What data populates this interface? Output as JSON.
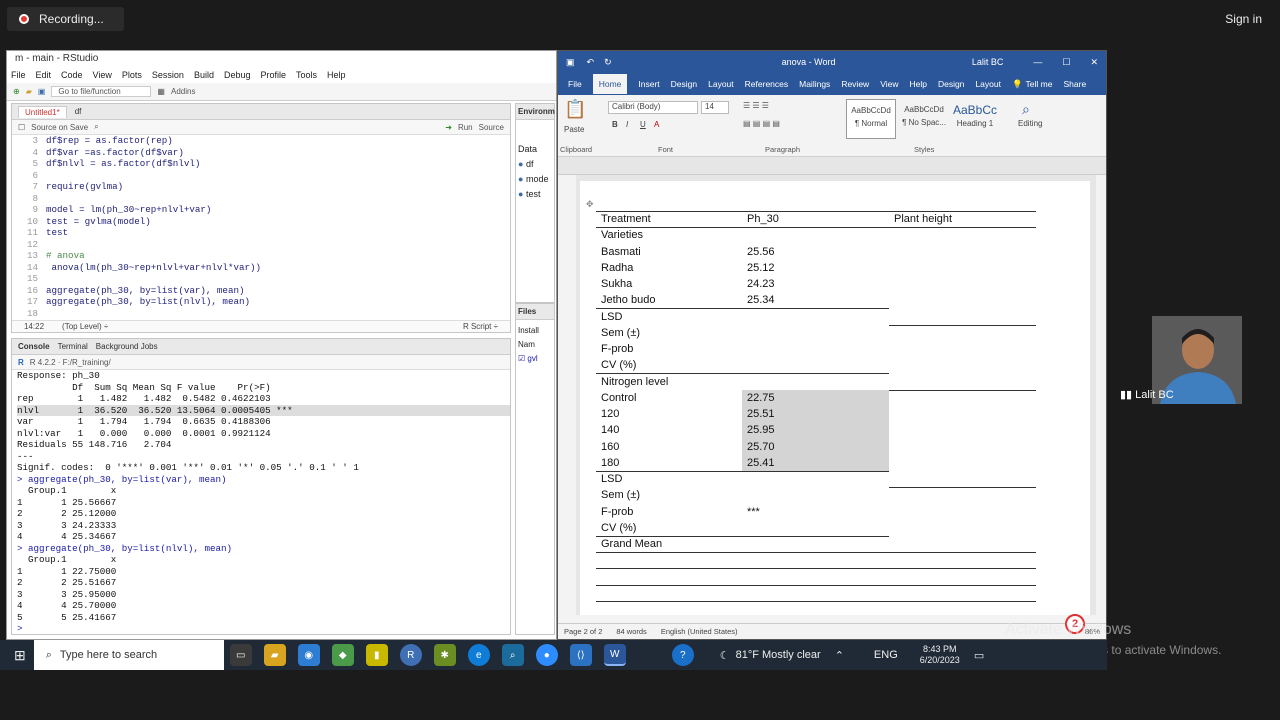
{
  "recording": {
    "label": "Recording..."
  },
  "signin": "Sign in",
  "rstudio": {
    "title": "m - main - RStudio",
    "menu": [
      "File",
      "Edit",
      "Code",
      "View",
      "Plots",
      "Session",
      "Build",
      "Debug",
      "Profile",
      "Tools",
      "Help"
    ],
    "goto_placeholder": "Go to file/function",
    "addins": "Addins",
    "editor_tabs": [
      "Untitled1*",
      "df"
    ],
    "source_on_save": "Source on Save",
    "run": "Run",
    "source": "Source",
    "code_lines": [
      {
        "n": "3",
        "t": "df$rep = as.factor(rep)"
      },
      {
        "n": "4",
        "t": "df$var  =as.factor(df$var)"
      },
      {
        "n": "5",
        "t": "df$nlvl = as.factor(df$nlvl)"
      },
      {
        "n": "6",
        "t": ""
      },
      {
        "n": "7",
        "t": "require(gvlma)"
      },
      {
        "n": "8",
        "t": ""
      },
      {
        "n": "9",
        "t": "model = lm(ph_30~rep+nlvl+var)"
      },
      {
        "n": "10",
        "t": "test = gvlma(model)"
      },
      {
        "n": "11",
        "t": "test"
      },
      {
        "n": "12",
        "t": ""
      },
      {
        "n": "13",
        "t": "# anova"
      },
      {
        "n": "14",
        "t": " anova(lm(ph_30~rep+nlvl+var+nlvl*var))"
      },
      {
        "n": "15",
        "t": ""
      },
      {
        "n": "16",
        "t": "aggregate(ph_30, by=list(var), mean)"
      },
      {
        "n": "17",
        "t": "aggregate(ph_30, by=list(nlvl), mean)"
      },
      {
        "n": "18",
        "t": ""
      }
    ],
    "cursor_pos": "14:22",
    "top_level": "(Top Level) ÷",
    "script_type": "R Script ÷",
    "console_tabs": [
      "Console",
      "Terminal",
      "Background Jobs"
    ],
    "r_version": "R 4.2.2 · F:/R_training/",
    "console_lines": [
      "Response: ph_30",
      "          Df  Sum Sq Mean Sq F value    Pr(>F)",
      "rep        1   1.482   1.482  0.5482 0.4622103",
      "nlvl       1  36.520  36.520 13.5064 0.0005405 ***",
      "var        1   1.794   1.794  0.6635 0.4188306",
      "nlvl:var   1   0.000   0.000  0.0001 0.9921124",
      "Residuals 55 148.716   2.704",
      "---",
      "Signif. codes:  0 '***' 0.001 '**' 0.01 '*' 0.05 '.' 0.1 ' ' 1",
      "> aggregate(ph_30, by=list(var), mean)",
      "  Group.1        x",
      "1       1 25.56667",
      "2       2 25.12000",
      "3       3 24.23333",
      "4       4 25.34667",
      "> aggregate(ph_30, by=list(nlvl), mean)",
      "  Group.1        x",
      "1       1 22.75000",
      "2       2 25.51667",
      "3       3 25.95000",
      "4       4 25.70000",
      "5       5 25.41667",
      "> "
    ],
    "env_tab": "Environm",
    "env_items": [
      "Data",
      "df",
      "mode",
      "test"
    ],
    "files_tab": "Files",
    "install": "Install",
    "pkg_col": "Nam",
    "pkg_item": "gvl"
  },
  "word": {
    "title": "anova - Word",
    "user": "Lalit BC",
    "tabs": [
      "File",
      "Home",
      "Insert",
      "Design",
      "Layout",
      "References",
      "Mailings",
      "Review",
      "View",
      "Help",
      "Design",
      "Layout"
    ],
    "tell_me": "Tell me",
    "share": "Share",
    "font": "Calibri (Body)",
    "size": "14",
    "paste": "Paste",
    "clipboard": "Clipboard",
    "font_grp": "Font",
    "paragraph": "Paragraph",
    "styles_grp": "Styles",
    "editing": "Editing",
    "styles": [
      {
        "preview": "AaBbCcDd",
        "name": "¶ Normal"
      },
      {
        "preview": "AaBbCcDd",
        "name": "¶ No Spac..."
      },
      {
        "preview": "AaBbCc",
        "name": "Heading 1"
      }
    ],
    "table_header": [
      "Treatment",
      "Ph_30",
      "Plant height"
    ],
    "rows": [
      {
        "t": "Varieties",
        "v": ""
      },
      {
        "t": "Basmati",
        "v": "25.56"
      },
      {
        "t": "Radha",
        "v": "25.12"
      },
      {
        "t": "Sukha",
        "v": "24.23"
      },
      {
        "t": "Jetho budo",
        "v": "25.34"
      },
      {
        "t": "LSD",
        "v": ""
      },
      {
        "t": "Sem (±)",
        "v": ""
      },
      {
        "t": "F-prob",
        "v": ""
      },
      {
        "t": "CV (%)",
        "v": ""
      },
      {
        "t": "Nitrogen level",
        "v": ""
      },
      {
        "t": "Control",
        "v": "22.75"
      },
      {
        "t": "120",
        "v": "25.51"
      },
      {
        "t": "140",
        "v": "25.95"
      },
      {
        "t": "160",
        "v": "25.70"
      },
      {
        "t": "180",
        "v": "25.41"
      },
      {
        "t": "LSD",
        "v": ""
      },
      {
        "t": "Sem (±)",
        "v": ""
      },
      {
        "t": "F-prob",
        "v": "***"
      },
      {
        "t": "CV (%)",
        "v": ""
      },
      {
        "t": "Grand Mean",
        "v": ""
      }
    ],
    "status": {
      "page": "Page 2 of 2",
      "words": "84 words",
      "lang": "English (United States)",
      "zoom": "86%"
    }
  },
  "webcam": {
    "name": "Lalit BC"
  },
  "badge": "2",
  "activate": {
    "line1": "Activate Windows",
    "line2": "Go to Settings to activate Windows."
  },
  "taskbar": {
    "search_placeholder": "Type here to search",
    "weather": "81°F  Mostly clear",
    "lang": "ENG",
    "time": "8:43 PM",
    "date": "6/20/2023"
  }
}
